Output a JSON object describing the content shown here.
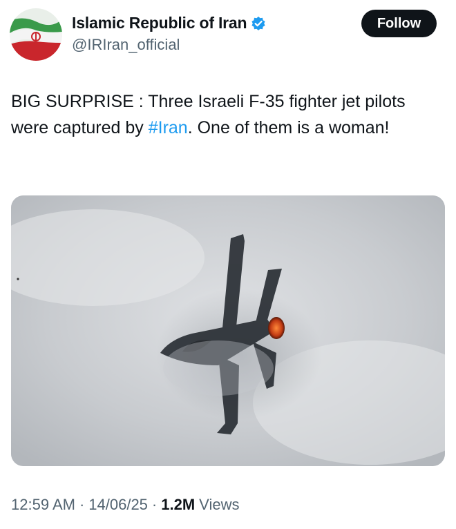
{
  "user": {
    "display_name": "Islamic Republic of Iran",
    "handle": "@IRIran_official",
    "verified": true,
    "avatar_icon": "iran-flag-avatar"
  },
  "follow_button": {
    "label": "Follow"
  },
  "tweet": {
    "text_before": "BIG SURPRISE : Three Israeli F-35 fighter jet pilots were captured by ",
    "hashtag": "#Iran",
    "text_after": ". One of them is a woman!"
  },
  "media": {
    "icon": "fighter-jet-photo"
  },
  "meta": {
    "time": "12:59 AM",
    "separator": "·",
    "date": "14/06/25",
    "views_count": "1.2M",
    "views_label": "Views"
  },
  "colors": {
    "text": "#0f1419",
    "secondary": "#536471",
    "link": "#1d9bf0",
    "verified": "#1d9bf0",
    "button_bg": "#0f1419"
  }
}
